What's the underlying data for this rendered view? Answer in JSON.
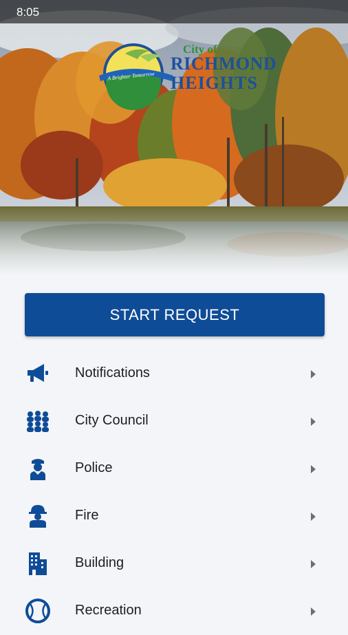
{
  "status_bar": {
    "time": "8:05"
  },
  "logo": {
    "city_of": "City of",
    "name_line1": "RICHMOND",
    "name_line2": "HEIGHTS",
    "tagline": "A Brighter Tomorrow"
  },
  "start_button": {
    "label": "START REQUEST"
  },
  "menu": {
    "items": [
      {
        "label": "Notifications",
        "icon": "megaphone-icon"
      },
      {
        "label": "City Council",
        "icon": "people-group-icon"
      },
      {
        "label": "Police",
        "icon": "police-officer-icon"
      },
      {
        "label": "Fire",
        "icon": "firefighter-icon"
      },
      {
        "label": "Building",
        "icon": "building-icon"
      },
      {
        "label": "Recreation",
        "icon": "baseball-icon"
      }
    ]
  },
  "colors": {
    "primary": "#0f4c97",
    "background": "#f3f5f8",
    "text": "#1b1f24"
  }
}
